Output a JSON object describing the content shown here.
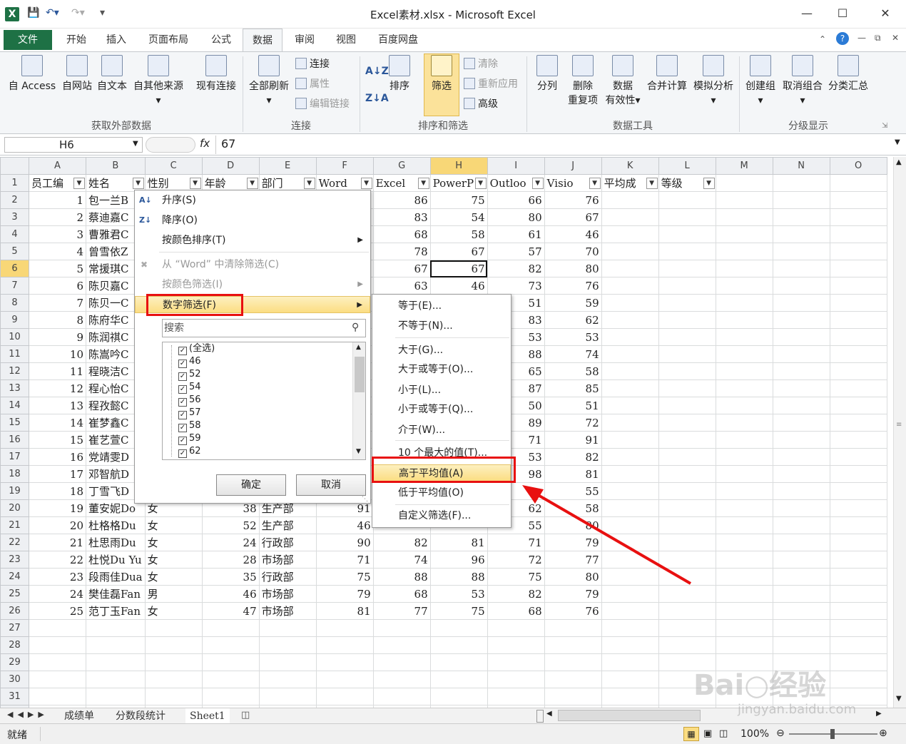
{
  "window": {
    "title": "Excel素材.xlsx - Microsoft Excel"
  },
  "tabs": [
    "文件",
    "开始",
    "插入",
    "页面布局",
    "公式",
    "数据",
    "审阅",
    "视图",
    "百度网盘"
  ],
  "ribbon": {
    "get_external": {
      "title": "获取外部数据",
      "buttons": [
        "自 Access",
        "自网站",
        "自文本",
        "自其他来源",
        "现有连接"
      ]
    },
    "connections": {
      "title": "连接",
      "refresh": "全部刷新",
      "connect": "连接",
      "properties": "属性",
      "edit_links": "编辑链接"
    },
    "sort_filter": {
      "title": "排序和筛选",
      "sort": "排序",
      "filter": "筛选",
      "clear": "清除",
      "reapply": "重新应用",
      "advanced": "高级"
    },
    "data_tools": {
      "title": "数据工具",
      "split": "分列",
      "remove_dup_1": "删除",
      "remove_dup_2": "重复项",
      "validation_1": "数据",
      "validation_2": "有效性",
      "consolidate": "合并计算",
      "whatif": "模拟分析"
    },
    "outline": {
      "title": "分级显示",
      "group": "创建组",
      "ungroup": "取消组合",
      "subtotal": "分类汇总"
    }
  },
  "formula_bar": {
    "name_box": "H6",
    "value": "67"
  },
  "columns": [
    "A",
    "B",
    "C",
    "D",
    "E",
    "F",
    "G",
    "H",
    "I",
    "J",
    "K",
    "L",
    "M",
    "N",
    "O"
  ],
  "headers": [
    "员工编",
    "姓名",
    "性别",
    "年龄",
    "部门",
    "Word",
    "Excel",
    "PowerP",
    "Outloo",
    "Visio",
    "平均成",
    "等级"
  ],
  "rows": [
    [
      "1",
      "包一兰B",
      "",
      "",
      "",
      "",
      "86",
      "75",
      "66",
      "76"
    ],
    [
      "2",
      "蔡迪嘉C",
      "",
      "",
      "",
      "",
      "83",
      "54",
      "80",
      "67"
    ],
    [
      "3",
      "曹雅君C",
      "",
      "",
      "",
      "",
      "68",
      "58",
      "61",
      "46"
    ],
    [
      "4",
      "曾雪依Z",
      "",
      "",
      "",
      "",
      "78",
      "67",
      "57",
      "70"
    ],
    [
      "5",
      "常援琪C",
      "",
      "",
      "",
      "",
      "67",
      "67",
      "82",
      "80"
    ],
    [
      "6",
      "陈贝嘉C",
      "",
      "",
      "",
      "",
      "63",
      "46",
      "73",
      "76"
    ],
    [
      "7",
      "陈贝一C",
      "",
      "",
      "",
      "",
      "",
      "",
      "51",
      "59"
    ],
    [
      "8",
      "陈府华C",
      "",
      "",
      "",
      "",
      "",
      "",
      "83",
      "62"
    ],
    [
      "9",
      "陈润祺C",
      "",
      "",
      "",
      "",
      "",
      "",
      "53",
      "53"
    ],
    [
      "10",
      "陈嵩吟C",
      "",
      "",
      "",
      "",
      "",
      "",
      "88",
      "74"
    ],
    [
      "11",
      "程晓洁C",
      "",
      "",
      "",
      "",
      "",
      "",
      "65",
      "58"
    ],
    [
      "12",
      "程心怡C",
      "",
      "",
      "",
      "",
      "",
      "",
      "87",
      "85"
    ],
    [
      "13",
      "程孜懿C",
      "",
      "",
      "",
      "",
      "",
      "",
      "50",
      "51"
    ],
    [
      "14",
      "崔梦鑫C",
      "",
      "",
      "",
      "",
      "",
      "",
      "89",
      "72"
    ],
    [
      "15",
      "崔艺萱C",
      "",
      "",
      "",
      "",
      "",
      "",
      "71",
      "91"
    ],
    [
      "16",
      "党靖雯D",
      "",
      "",
      "",
      "",
      "",
      "",
      "53",
      "82"
    ],
    [
      "17",
      "邓智航D",
      "",
      "",
      "",
      "",
      "",
      "",
      "98",
      "81"
    ],
    [
      "18",
      "丁雪飞D",
      "",
      "",
      "",
      "",
      "",
      "",
      "",
      "55"
    ],
    [
      "19",
      "董安妮Do",
      "女",
      "38",
      "生产部",
      "91",
      "",
      "",
      "62",
      "58"
    ],
    [
      "20",
      "杜格格Du",
      "女",
      "52",
      "生产部",
      "46",
      "",
      "",
      "55",
      "80"
    ],
    [
      "21",
      "杜思雨Du",
      "女",
      "24",
      "行政部",
      "90",
      "82",
      "81",
      "71",
      "79"
    ],
    [
      "22",
      "杜悦Du Yu",
      "女",
      "28",
      "市场部",
      "71",
      "74",
      "96",
      "72",
      "77"
    ],
    [
      "23",
      "段雨佳Dua",
      "女",
      "35",
      "行政部",
      "75",
      "88",
      "88",
      "75",
      "80"
    ],
    [
      "24",
      "樊佳磊Fan",
      "男",
      "46",
      "市场部",
      "79",
      "68",
      "53",
      "82",
      "79"
    ],
    [
      "25",
      "范丁玉Fan",
      "女",
      "47",
      "市场部",
      "81",
      "77",
      "75",
      "68",
      "76"
    ]
  ],
  "dropdown": {
    "sort_asc": "升序(S)",
    "sort_desc": "降序(O)",
    "sort_color": "按颜色排序(T)",
    "clear_filter": "从 “Word” 中清除筛选(C)",
    "filter_color": "按颜色筛选(I)",
    "number_filter": "数字筛选(F)",
    "search_placeholder": "搜索",
    "values": [
      "(全选)",
      "46",
      "52",
      "54",
      "56",
      "57",
      "58",
      "59",
      "62"
    ],
    "ok": "确定",
    "cancel": "取消"
  },
  "submenu": {
    "items": [
      "等于(E)...",
      "不等于(N)...",
      "大于(G)...",
      "大于或等于(O)...",
      "小于(L)...",
      "小于或等于(Q)...",
      "介于(W)...",
      "10 个最大的值(T)...",
      "高于平均值(A)",
      "低于平均值(O)",
      "自定义筛选(F)..."
    ]
  },
  "sheet_tabs": [
    "成绩单",
    "分数段统计",
    "Sheet1"
  ],
  "status": {
    "ready": "就绪",
    "zoom": "100%"
  },
  "colors": {
    "excel_green": "#1e7145",
    "highlight": "#fbdd82",
    "annotation_red": "#e81010"
  }
}
